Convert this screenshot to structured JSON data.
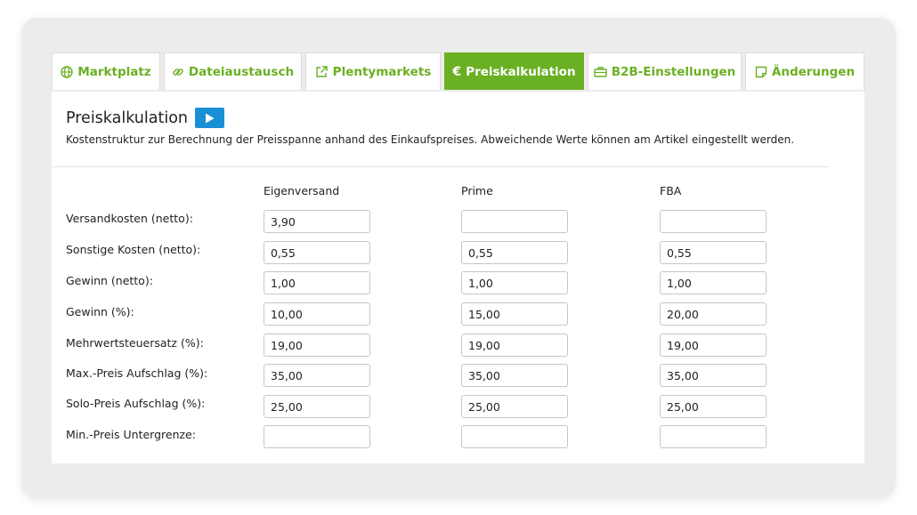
{
  "tabs": [
    {
      "label": "Marktplatz",
      "icon": "globe-icon",
      "active": false
    },
    {
      "label": "Dateiaustausch",
      "icon": "link-icon",
      "active": false
    },
    {
      "label": "Plentymarkets",
      "icon": "external-link-icon",
      "active": false
    },
    {
      "label": "Preiskalkulation",
      "icon": "euro-icon",
      "active": true
    },
    {
      "label": "B2B-Einstellungen",
      "icon": "briefcase-icon",
      "active": false
    },
    {
      "label": "Änderungen",
      "icon": "note-icon",
      "active": false
    }
  ],
  "panel": {
    "title": "Preiskalkulation",
    "description": "Kostenstruktur zur Berechnung der Preisspanne anhand des Einkaufspreises. Abweichende Werte können am Artikel eingestellt werden."
  },
  "table": {
    "columns": [
      "Eigenversand",
      "Prime",
      "FBA"
    ],
    "rows": [
      {
        "label": "Versandkosten (netto):",
        "values": [
          "3,90",
          "",
          ""
        ]
      },
      {
        "label": "Sonstige Kosten (netto):",
        "values": [
          "0,55",
          "0,55",
          "0,55"
        ]
      },
      {
        "label": "Gewinn (netto):",
        "values": [
          "1,00",
          "1,00",
          "1,00"
        ]
      },
      {
        "label": "Gewinn (%):",
        "values": [
          "10,00",
          "15,00",
          "20,00"
        ]
      },
      {
        "label": "Mehrwertsteuersatz (%):",
        "values": [
          "19,00",
          "19,00",
          "19,00"
        ]
      },
      {
        "label": "Max.-Preis Aufschlag (%):",
        "values": [
          "35,00",
          "35,00",
          "35,00"
        ]
      },
      {
        "label": "Solo-Preis Aufschlag (%):",
        "values": [
          "25,00",
          "25,00",
          "25,00"
        ]
      },
      {
        "label": "Min.-Preis Untergrenze:",
        "values": [
          "",
          "",
          ""
        ]
      }
    ]
  },
  "colors": {
    "accent": "#6ab023",
    "play_button": "#1a8fd6"
  }
}
